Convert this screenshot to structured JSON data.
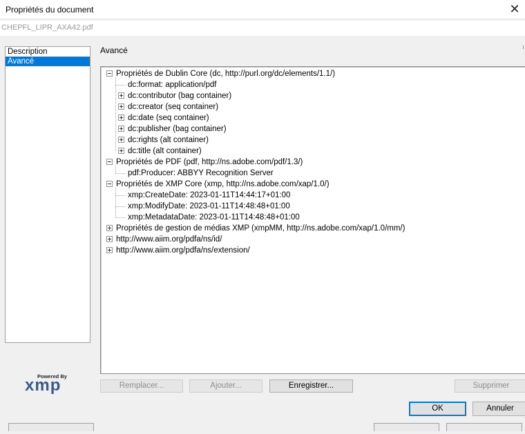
{
  "window": {
    "title": "Propriétés du document",
    "filename": "CHEPFL_LIPR_AXA42.pdf",
    "close_glyph": "✕"
  },
  "sidebar": {
    "items": [
      {
        "label": "Description"
      },
      {
        "label": "Avancé"
      }
    ]
  },
  "section_title": "Avancé",
  "tree": [
    {
      "label": "Propriétés de Dublin Core (dc, http://purl.org/dc/elements/1.1/)",
      "expanded": true
    },
    {
      "label": "dc:format: application/pdf"
    },
    {
      "label": "dc:contributor (bag container)",
      "expanded": false
    },
    {
      "label": "dc:creator (seq container)",
      "expanded": false
    },
    {
      "label": "dc:date (seq container)",
      "expanded": false
    },
    {
      "label": "dc:publisher (bag container)",
      "expanded": false
    },
    {
      "label": "dc:rights (alt container)",
      "expanded": false
    },
    {
      "label": "dc:title (alt container)",
      "expanded": false
    },
    {
      "label": "Propriétés de PDF (pdf, http://ns.adobe.com/pdf/1.3/)",
      "expanded": true
    },
    {
      "label": "pdf:Producer: ABBYY Recognition Server"
    },
    {
      "label": "Propriétés de XMP Core (xmp, http://ns.adobe.com/xap/1.0/)",
      "expanded": true
    },
    {
      "label": "xmp:CreateDate: 2023-01-11T14:44:17+01:00"
    },
    {
      "label": "xmp:ModifyDate: 2023-01-11T14:48:48+01:00"
    },
    {
      "label": "xmp:MetadataDate: 2023-01-11T14:48:48+01:00"
    },
    {
      "label": "Propriétés de gestion de médias XMP (xmpMM, http://ns.adobe.com/xap/1.0/mm/)",
      "expanded": false
    },
    {
      "label": "http://www.aiim.org/pdfa/ns/id/",
      "expanded": false
    },
    {
      "label": "http://www.aiim.org/pdfa/ns/extension/",
      "expanded": false
    }
  ],
  "buttons": {
    "replace": "Remplacer...",
    "add": "Ajouter...",
    "save": "Enregistrer...",
    "delete": "Supprimer",
    "ok": "OK",
    "cancel": "Annuler"
  },
  "logo": {
    "powered_by": "Powered By",
    "brand": "xmp"
  },
  "colors": {
    "selection": "#0078d7",
    "logo": "#3b5b86"
  }
}
